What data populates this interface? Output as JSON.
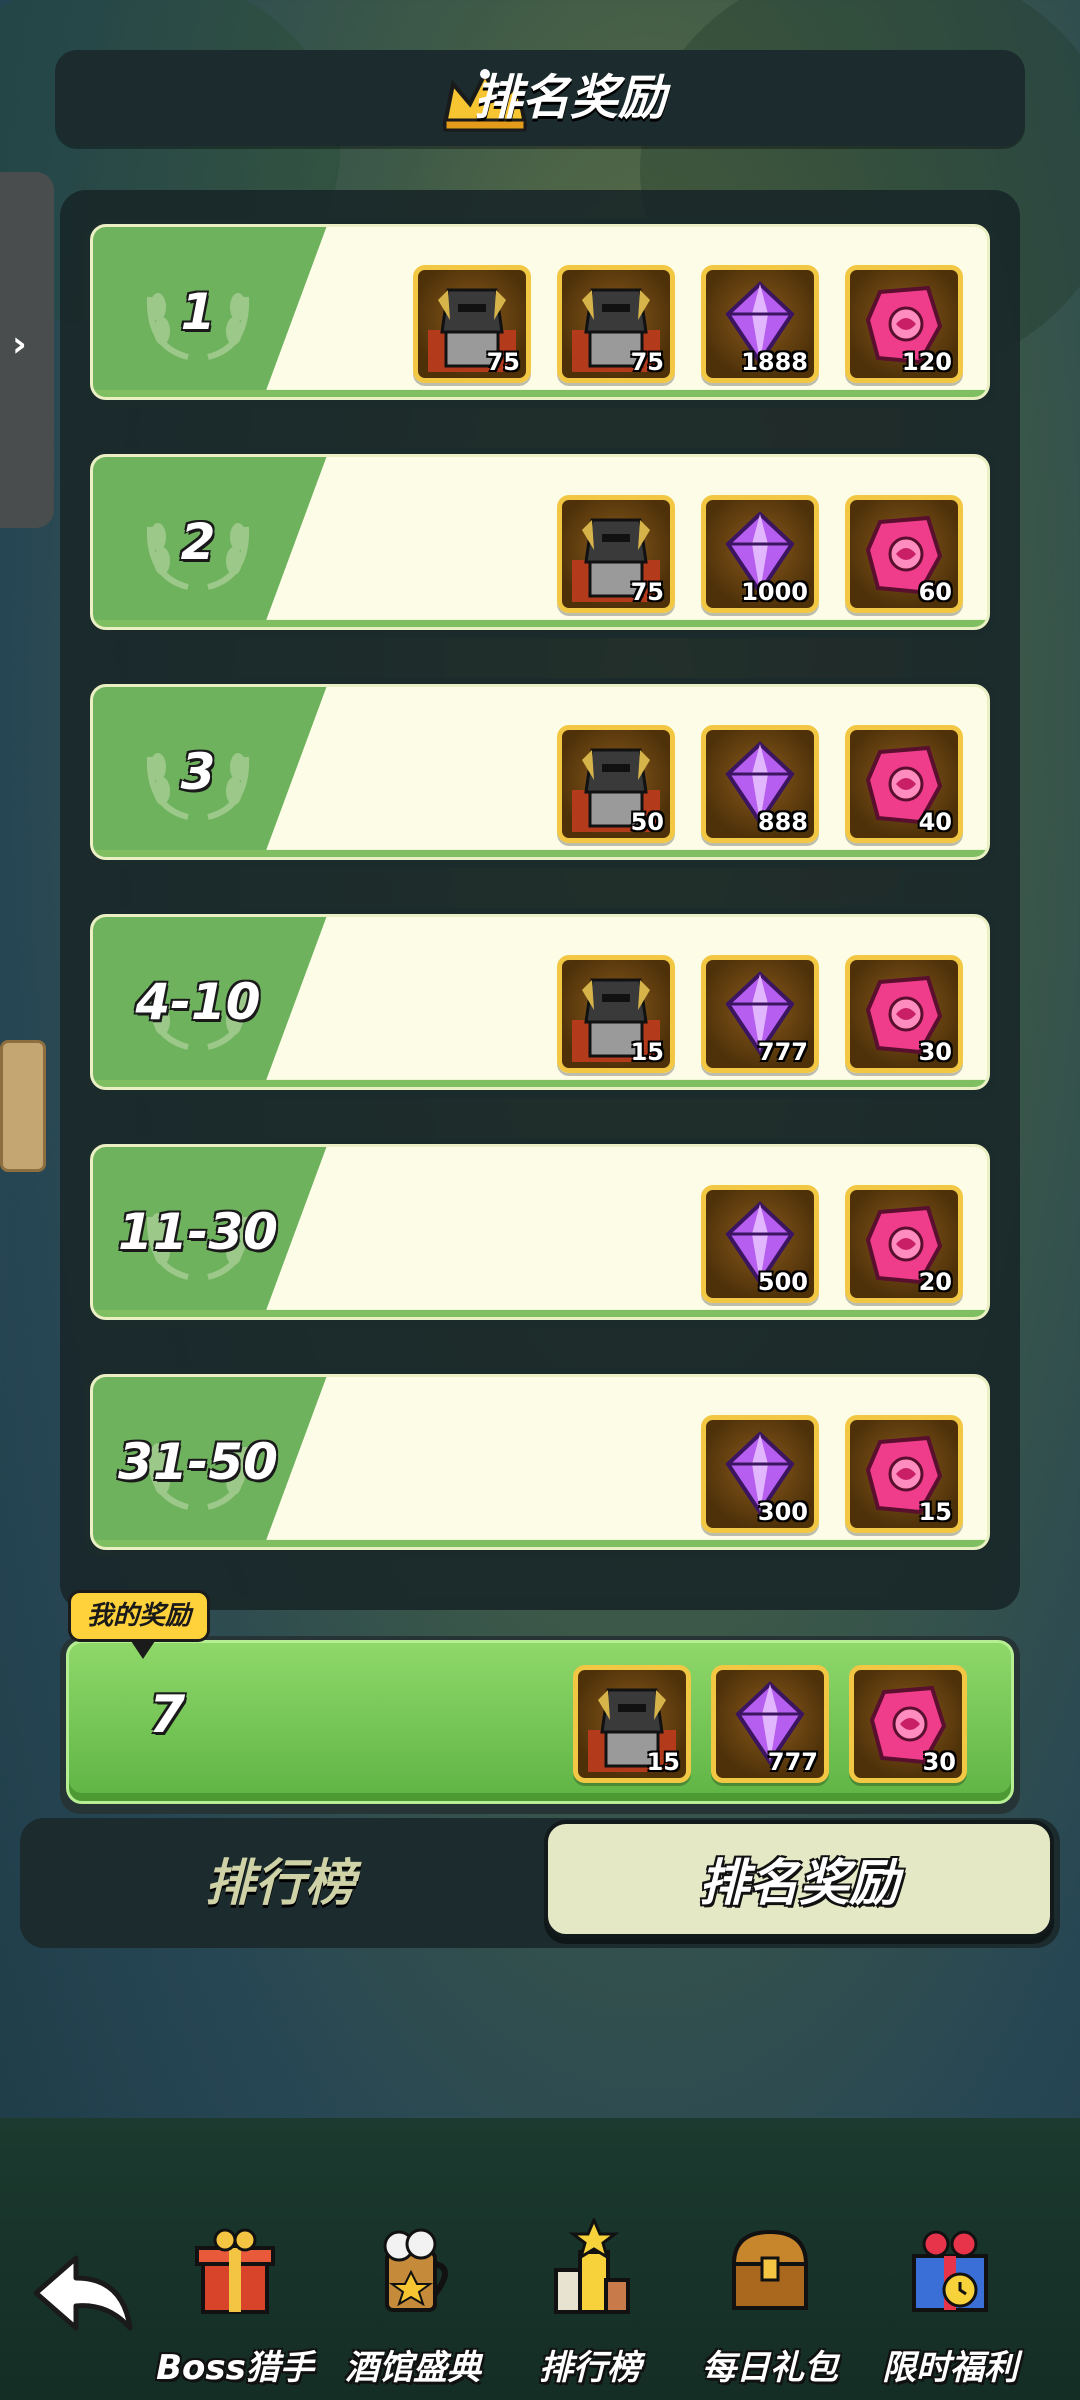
{
  "header": {
    "title": "排名奖励"
  },
  "rows": [
    {
      "rank": "1",
      "items": [
        {
          "icon": "knight-hero-icon",
          "count": "75"
        },
        {
          "icon": "knight-hero-icon",
          "count": "75"
        },
        {
          "icon": "purple-gem-icon",
          "count": "1888"
        },
        {
          "icon": "pink-crystal-icon",
          "count": "120"
        }
      ]
    },
    {
      "rank": "2",
      "items": [
        {
          "icon": "knight-hero-icon",
          "count": "75"
        },
        {
          "icon": "purple-gem-icon",
          "count": "1000"
        },
        {
          "icon": "pink-crystal-icon",
          "count": "60"
        }
      ]
    },
    {
      "rank": "3",
      "items": [
        {
          "icon": "knight-hero-icon",
          "count": "50"
        },
        {
          "icon": "purple-gem-icon",
          "count": "888"
        },
        {
          "icon": "pink-crystal-icon",
          "count": "40"
        }
      ]
    },
    {
      "rank": "4-10",
      "items": [
        {
          "icon": "knight-hero-icon",
          "count": "15"
        },
        {
          "icon": "purple-gem-icon",
          "count": "777"
        },
        {
          "icon": "pink-crystal-icon",
          "count": "30"
        }
      ]
    },
    {
      "rank": "11-30",
      "items": [
        {
          "icon": "purple-gem-icon",
          "count": "500"
        },
        {
          "icon": "pink-crystal-icon",
          "count": "20"
        }
      ]
    },
    {
      "rank": "31-50",
      "items": [
        {
          "icon": "purple-gem-icon",
          "count": "300"
        },
        {
          "icon": "pink-crystal-icon",
          "count": "15"
        }
      ]
    }
  ],
  "my_reward": {
    "badge": "我的奖励",
    "rank": "7",
    "items": [
      {
        "icon": "knight-hero-icon",
        "count": "15"
      },
      {
        "icon": "purple-gem-icon",
        "count": "777"
      },
      {
        "icon": "pink-crystal-icon",
        "count": "30"
      }
    ]
  },
  "tabs": {
    "leaderboard": "排行榜",
    "rank_rewards": "排名奖励",
    "active": "rank_rewards"
  },
  "bottom_nav": {
    "items": [
      {
        "label": "Boss猎手",
        "icon": "gift-box-icon"
      },
      {
        "label": "酒馆盛典",
        "icon": "beer-mug-icon"
      },
      {
        "label": "排行榜",
        "icon": "trophy-icon"
      },
      {
        "label": "每日礼包",
        "icon": "treasure-chest-icon"
      },
      {
        "label": "限时福利",
        "icon": "timed-gift-icon"
      }
    ]
  },
  "colors": {
    "row_green": "#6fb25e",
    "row_cream": "#fdfde7",
    "item_border": "#f2c744",
    "badge": "#ffd23b"
  }
}
